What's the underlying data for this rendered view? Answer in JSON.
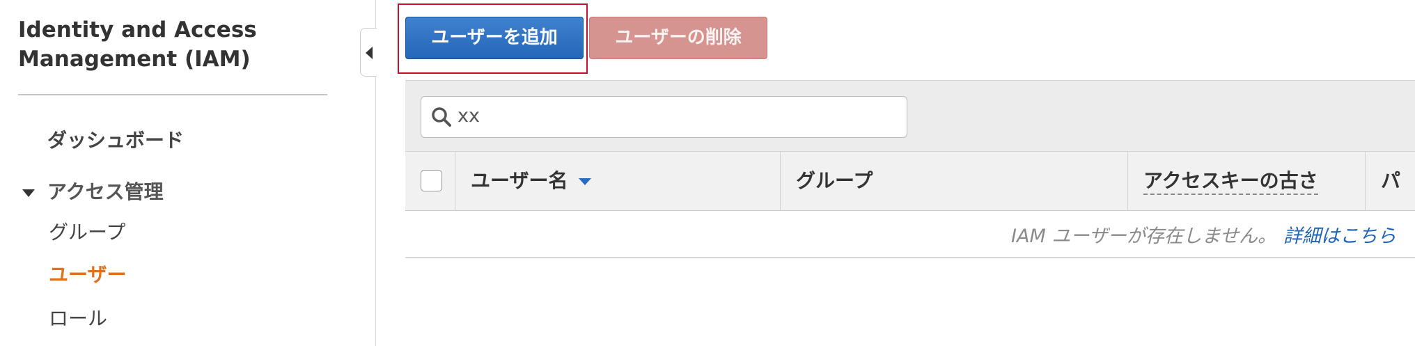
{
  "sidebar": {
    "title": "Identity and Access Management (IAM)",
    "items": {
      "dashboard": "ダッシュボード",
      "access_management": "アクセス管理",
      "groups": "グループ",
      "users": "ユーザー",
      "roles": "ロール"
    },
    "active_color": "#e0711d"
  },
  "toolbar": {
    "add_user_label": "ユーザーを追加",
    "delete_user_label": "ユーザーの削除"
  },
  "search": {
    "value": "xx",
    "icon": "search-icon"
  },
  "table": {
    "columns": [
      "ユーザー名",
      "グループ",
      "アクセスキーの古さ",
      "パ"
    ],
    "empty_message": "IAM ユーザーが存在しません。",
    "empty_link": "詳細はこちら"
  },
  "colors": {
    "primary_button": "#2566b8",
    "danger_button_disabled": "#d69491",
    "link": "#1f64b5",
    "highlight": "#c8102e"
  }
}
